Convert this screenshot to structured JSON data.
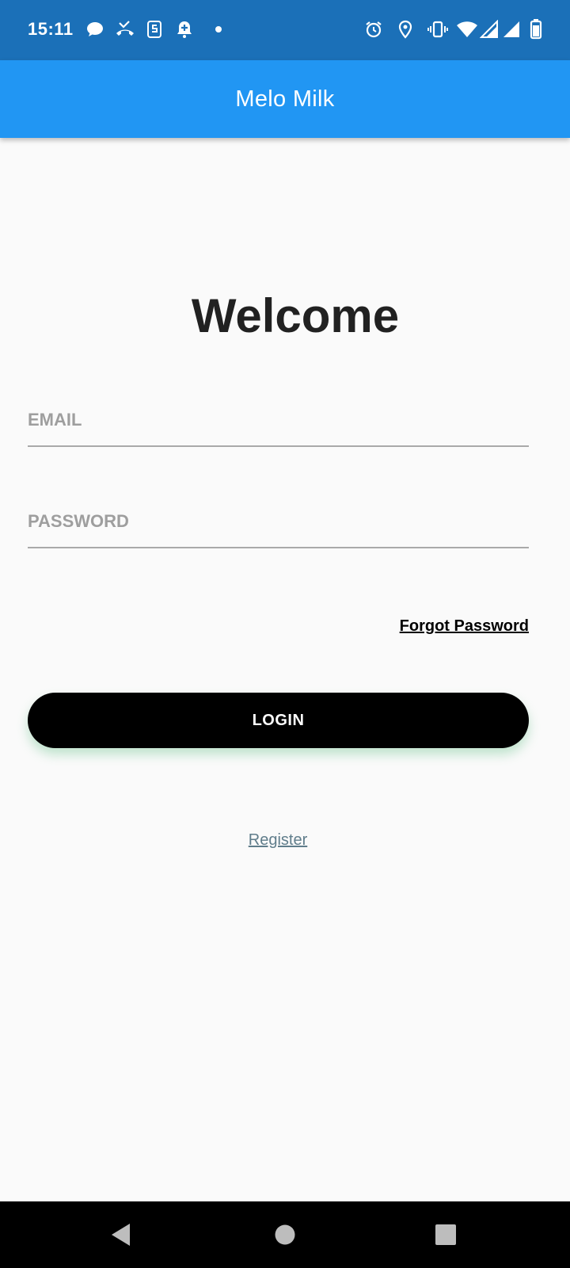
{
  "status_bar": {
    "time": "15:11",
    "left_icons": [
      "chat-bubble-icon",
      "missed-call-icon",
      "sim-toolkit-icon",
      "notification-add-icon",
      "dot-icon"
    ],
    "right_icons": [
      "alarm-icon",
      "location-icon",
      "vibrate-icon",
      "wifi-icon",
      "signal-icon",
      "signal-icon",
      "battery-icon"
    ]
  },
  "app_bar": {
    "title": "Melo Milk"
  },
  "login": {
    "heading": "Welcome",
    "email_placeholder": "EMAIL",
    "password_placeholder": "PASSWORD",
    "forgot_password": "Forgot Password",
    "login_label": "LOGIN",
    "register_label": "Register"
  },
  "colors": {
    "status_bar": "#1b70b8",
    "app_bar": "#2196f3",
    "background": "#fafafa",
    "login_button": "#000000",
    "register_link": "#607d8b"
  },
  "nav_bar": {
    "icons": [
      "back-icon",
      "home-icon",
      "recents-icon"
    ]
  }
}
